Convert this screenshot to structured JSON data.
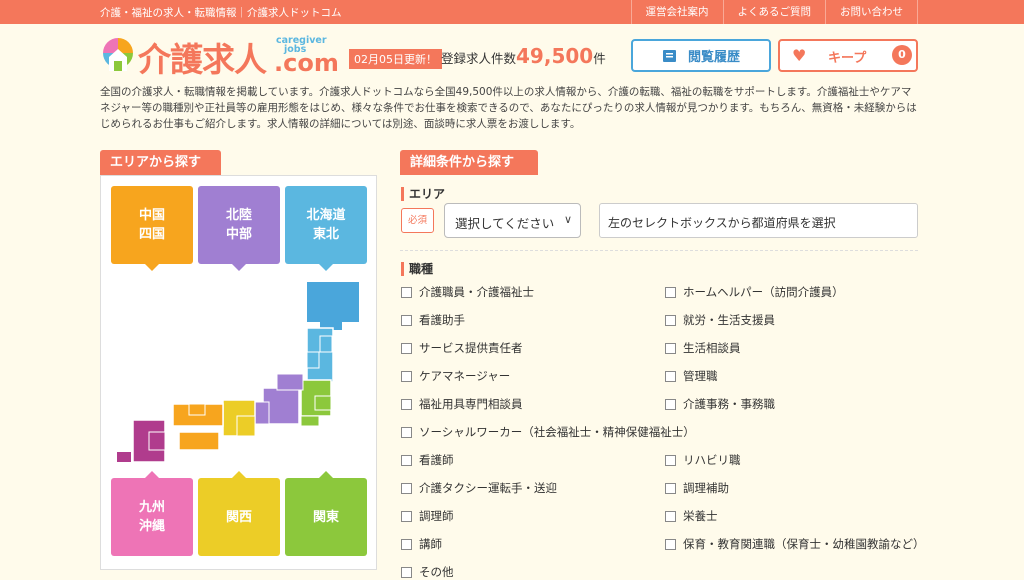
{
  "topbar": {
    "tagline": "介護・福祉の求人・転職情報｜介護求人ドットコム",
    "nav": [
      "運営会社案内",
      "よくあるご質問",
      "お問い合わせ"
    ]
  },
  "header": {
    "logo_main": "介護求人",
    "logo_sub1": "caregiver",
    "logo_sub2": "jobs",
    "logo_com": ".com",
    "update_badge": "02月05日更新！",
    "count_label": "登録求人件数",
    "count_value": "49,500",
    "count_unit": "件",
    "history_label": "閲覧履歴",
    "keep_label": "キープ",
    "keep_count": "0"
  },
  "intro": "全国の介護求人・転職情報を掲載しています。介護求人ドットコムなら全国49,500件以上の求人情報から、介護の転職、福祉の転職をサポートします。介護福祉士やケアマネジャー等の職種別や正社員等の雇用形態をはじめ、様々な条件でお仕事を検索できるので、あなたにぴったりの求人情報が見つかります。もちろん、無資格・未経験からはじめられるお仕事もご紹介します。求人情報の詳細については別途、面談時に求人票をお渡しします。",
  "area_search": {
    "title": "エリアから探す",
    "regions": [
      {
        "id": "chugoku",
        "label": "中国\n四国",
        "color": "#f7a51e"
      },
      {
        "id": "hokuriku",
        "label": "北陸\n中部",
        "color": "#a07fd2"
      },
      {
        "id": "hokkaido",
        "label": "北海道\n東北",
        "color": "#5bb7e0"
      },
      {
        "id": "kyushu",
        "label": "九州\n沖縄",
        "color": "#ee74b6"
      },
      {
        "id": "kansai",
        "label": "関西",
        "color": "#eccd27"
      },
      {
        "id": "kanto",
        "label": "関東",
        "color": "#8cc83c"
      }
    ]
  },
  "detail_search": {
    "title": "詳細条件から探す",
    "area_label": "エリア",
    "required_label": "必須",
    "select_placeholder": "選択してください",
    "pref_hint": "左のセレクトボックスから都道府県を選択",
    "job_label": "職種",
    "jobs": [
      "介護職員・介護福祉士",
      "ホームヘルパー（訪問介護員）",
      "看護助手",
      "就労・生活支援員",
      "サービス提供責任者",
      "生活相談員",
      "ケアマネージャー",
      "管理職",
      "福祉用具専門相談員",
      "介護事務・事務職",
      "ソーシャルワーカー（社会福祉士・精神保健福祉士）",
      "看護師",
      "リハビリ職",
      "介護タクシー運転手・送迎",
      "調理補助",
      "調理師",
      "栄養士",
      "講師",
      "保育・教育関連職（保育士・幼稚園教諭など）",
      "その他"
    ]
  },
  "colors": {
    "brand": "#f4775b",
    "blue": "#4aa6db"
  },
  "icons": {
    "history": "book-icon",
    "keep": "heart-icon",
    "logo": "house-logo-icon"
  }
}
